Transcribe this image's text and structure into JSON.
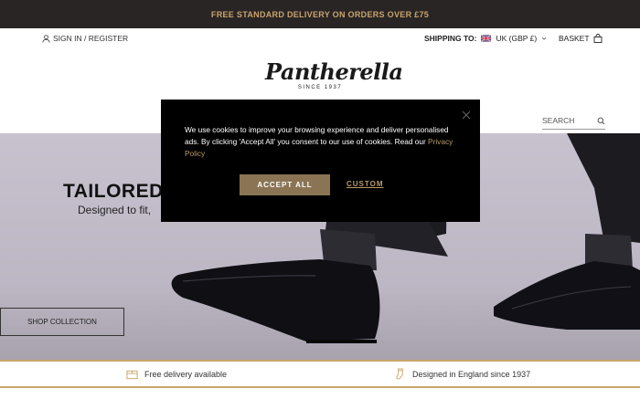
{
  "announcement": "FREE STANDARD DELIVERY ON ORDERS OVER £75",
  "header": {
    "signin": "SIGN IN / REGISTER",
    "shipping_label": "SHIPPING TO:",
    "shipping_value": "UK (GBP £)",
    "basket": "BASKET",
    "logo_script": "Pantherella",
    "logo_since": "SINCE 1937",
    "search_placeholder": "SEARCH"
  },
  "hero": {
    "title": "TAILORED",
    "subtitle": "Designed to fit,",
    "cta": "SHOP COLLECTION"
  },
  "features": [
    {
      "label": "Free delivery available",
      "icon": "box-icon"
    },
    {
      "label": "Designed in England since 1937",
      "icon": "sock-icon"
    }
  ],
  "cookie": {
    "text": "We use cookies to improve your browsing experience and deliver personalised ads. By clicking 'Accept All' you consent to our use of cookies. Read our ",
    "link": "Privacy Policy",
    "accept": "ACCEPT ALL",
    "custom": "CUSTOM"
  },
  "colors": {
    "topbar_bg": "#2a2525",
    "accent_gold": "#c8a46b",
    "accept_bg": "#8a7454"
  }
}
